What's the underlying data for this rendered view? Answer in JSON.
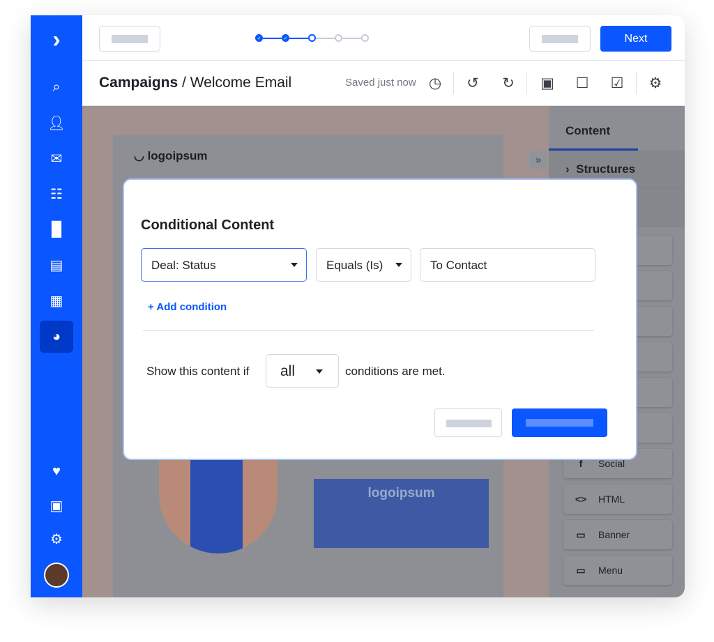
{
  "sidebar": {
    "items": [
      "logo",
      "search",
      "contacts",
      "email",
      "automations",
      "pipelines",
      "conversations",
      "site",
      "reports",
      "favorites",
      "apps",
      "settings",
      "profile"
    ],
    "active": "reports",
    "color": "#0a56ff"
  },
  "topbar": {
    "steps": [
      "done",
      "done",
      "current",
      "todo",
      "todo"
    ],
    "next_label": "Next"
  },
  "header": {
    "section": "Campaigns",
    "separator": " / ",
    "page": "Welcome Email",
    "saved_status": "Saved just now"
  },
  "canvas": {
    "logo_text": "logoipsum",
    "banner_logo_text": "logoipsum"
  },
  "panel": {
    "tab": "Content",
    "structures": "Structures",
    "blocks": [
      {
        "icon": "facebook-icon",
        "label": "Social"
      },
      {
        "icon": "code-icon",
        "label": "HTML"
      },
      {
        "icon": "banner-icon",
        "label": "Banner"
      },
      {
        "icon": "menu-icon",
        "label": "Menu"
      }
    ]
  },
  "modal": {
    "title": "Conditional Content",
    "field": "Deal: Status",
    "operator": "Equals (Is)",
    "value": "To Contact",
    "add_condition": "+ Add condition",
    "show_prefix": "Show this content if",
    "match": "all",
    "show_suffix": "conditions are met."
  }
}
